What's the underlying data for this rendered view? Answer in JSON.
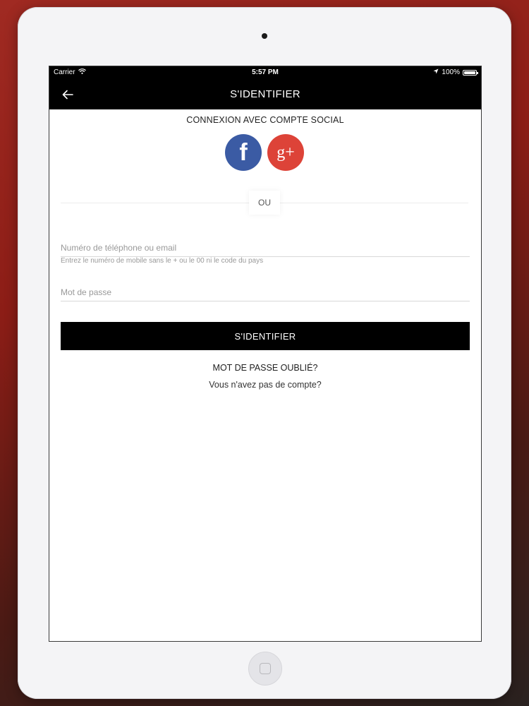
{
  "status_bar": {
    "carrier": "Carrier",
    "time": "5:57 PM",
    "battery": "100%",
    "battery_level": 1.0,
    "icons": [
      "wifi-icon",
      "location-arrow-icon",
      "battery-icon"
    ]
  },
  "nav": {
    "title": "S'IDENTIFIER",
    "back_icon": "arrow-left-icon"
  },
  "social": {
    "title": "CONNEXION AVEC COMPTE SOCIAL",
    "facebook_glyph": "f",
    "facebook_color": "#3b5ba4",
    "google_glyph": "g+",
    "google_color": "#dd4338"
  },
  "divider": {
    "label": "OU"
  },
  "form": {
    "phone_placeholder": "Numéro de téléphone ou email",
    "phone_value": "",
    "phone_hint": "Entrez le numéro de mobile sans le + ou le 00 ni le code du pays",
    "password_placeholder": "Mot de passe",
    "password_value": "",
    "submit_label": "S'IDENTIFIER"
  },
  "links": {
    "forgot_password": "MOT DE PASSE OUBLIÉ?",
    "no_account": "Vous n'avez pas de compte?"
  }
}
